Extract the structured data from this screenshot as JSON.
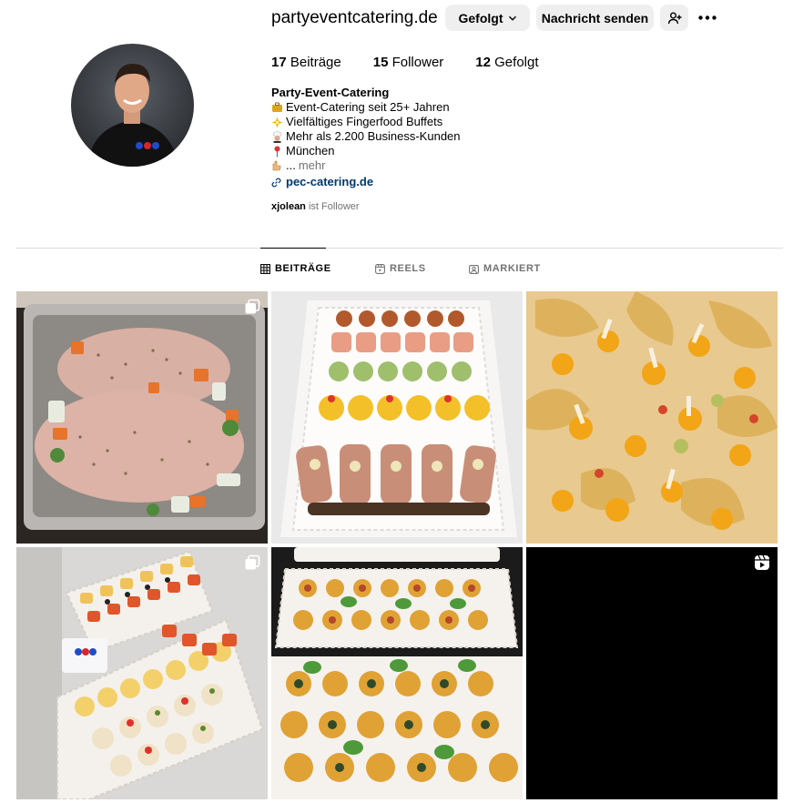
{
  "profile": {
    "username": "partyeventcatering.de",
    "follow_button": "Gefolgt",
    "message_button": "Nachricht senden",
    "stats": [
      {
        "count": "17",
        "label": "Beiträge"
      },
      {
        "count": "15",
        "label": "Follower"
      },
      {
        "count": "12",
        "label": "Gefolgt"
      }
    ],
    "bio": {
      "name": "Party-Event-Catering",
      "lines": [
        {
          "icon": "briefcase-emoji",
          "text": "Event-Catering seit 25+ Jahren"
        },
        {
          "icon": "sparkle-emoji",
          "text": "Vielfältiges Fingerfood Buffets"
        },
        {
          "icon": "chef-emoji",
          "text": "Mehr als 2.200 Business-Kunden"
        },
        {
          "icon": "pin-emoji",
          "text": "München"
        },
        {
          "icon": "pointing-hand-emoji",
          "text": "...",
          "more": "mehr"
        }
      ],
      "link": "pec-catering.de"
    },
    "followed_by": {
      "user": "xjolean",
      "text": "ist Follower"
    }
  },
  "tabs": [
    {
      "label": "BEITRÄGE",
      "icon": "grid-icon",
      "active": true
    },
    {
      "label": "REELS",
      "icon": "reels-icon",
      "active": false
    },
    {
      "label": "MARKIERT",
      "icon": "tagged-icon",
      "active": false
    }
  ],
  "posts": [
    {
      "subject": "roast-meat-tray",
      "badge": "carousel-icon"
    },
    {
      "subject": "canape-platter",
      "badge": ""
    },
    {
      "subject": "physalis-skewers",
      "badge": ""
    },
    {
      "subject": "finger-food-trays",
      "badge": "carousel-icon"
    },
    {
      "subject": "puff-pastry-rolls",
      "badge": ""
    },
    {
      "subject": "black-reel",
      "badge": "reel-icon"
    }
  ],
  "colors": {
    "link": "#00376b",
    "button_bg": "#efefef",
    "muted": "#737373",
    "divider": "#dbdbdb"
  }
}
